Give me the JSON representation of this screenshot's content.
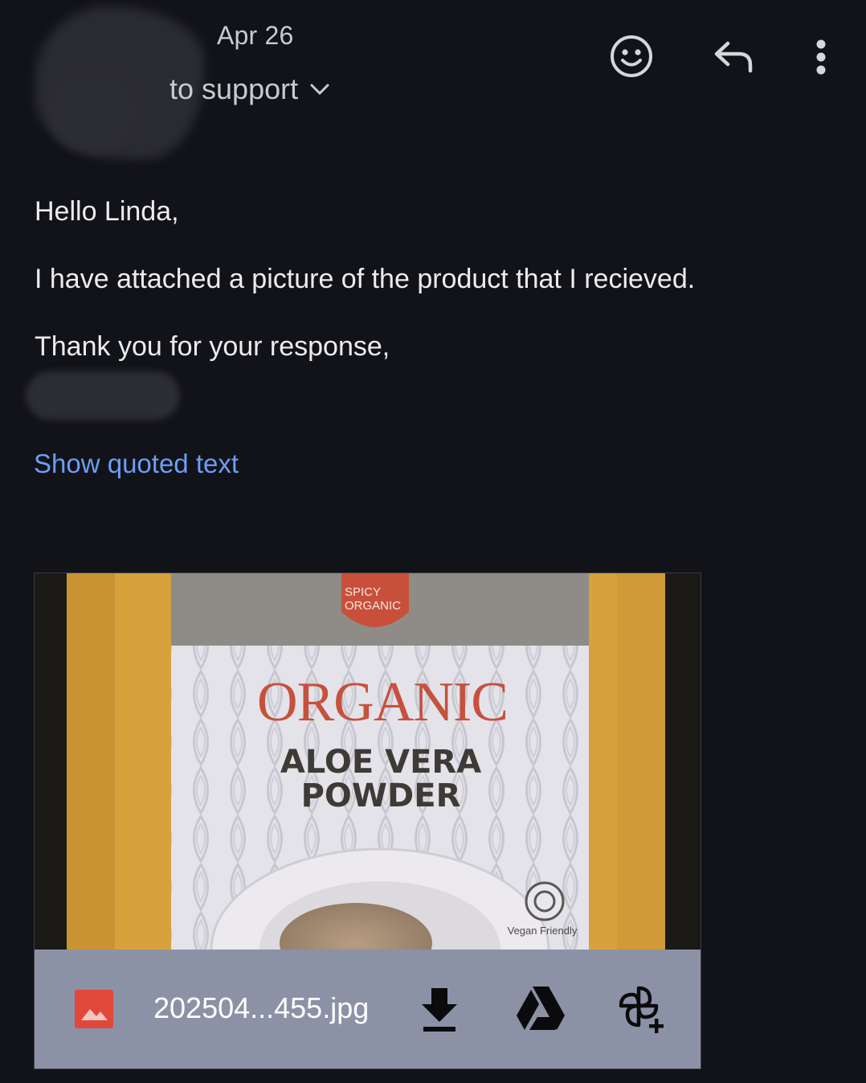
{
  "header": {
    "date": "Apr 26",
    "recipient": "to support",
    "icons": {
      "emoji": "emoji-reaction-icon",
      "reply": "reply-icon",
      "more": "more-vertical-icon",
      "expand": "chevron-down-icon"
    }
  },
  "message": {
    "greeting": "Hello Linda,",
    "body": "I have attached a picture of the product that I recieved.",
    "closing": "Thank you for your response,",
    "quoted_link": "Show quoted text"
  },
  "attachment": {
    "file_name": "202504...455.jpg",
    "file_type_icon": "image-file-icon",
    "actions": [
      "download-icon",
      "google-drive-icon",
      "add-to-photos-icon"
    ],
    "photo": {
      "brand_line1": "SPICY",
      "brand_line2": "ORGANIC",
      "headline": "ORGANIC",
      "product_line1": "ALOE VERA",
      "product_line2": "POWDER",
      "badge": "Vegan Friendly"
    }
  },
  "colors": {
    "background": "#121318",
    "link": "#6b9ef7",
    "attachment_bar": "#8c92a6",
    "file_icon": "#e0483a",
    "bag_kraft": "#d8a23c",
    "product_red": "#c8503a"
  }
}
